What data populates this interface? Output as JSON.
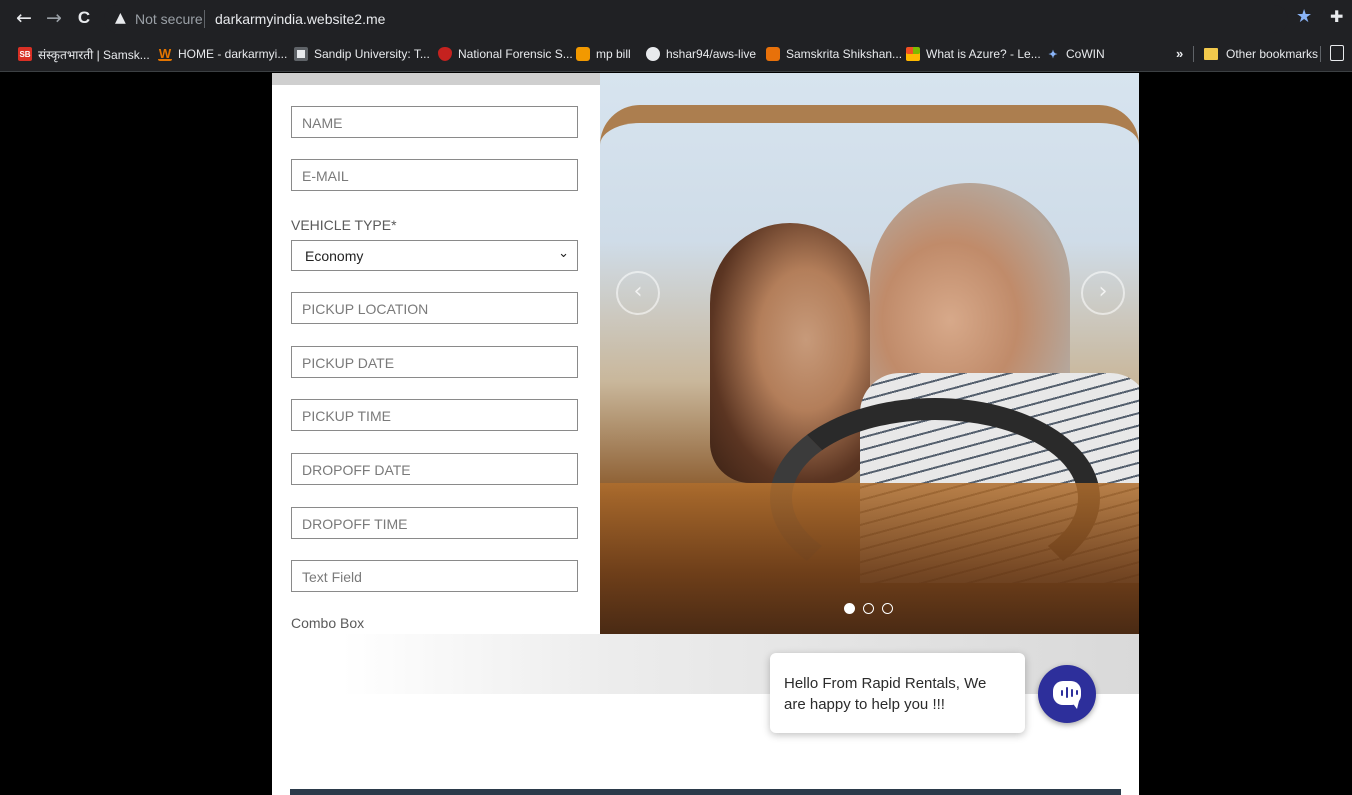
{
  "browser": {
    "nav": {
      "back": "←",
      "forward": "→",
      "reload": "C"
    },
    "security_status": "Not secure",
    "url": "darkarmyindia.website2.me",
    "more_bookmarks": "»",
    "other_bookmarks": "Other bookmarks"
  },
  "bookmarks": [
    {
      "label": "संस्कृतभारती | Samsk...",
      "icon": "sb-icon",
      "color": "#d93025",
      "glyph": "SB"
    },
    {
      "label": "HOME - darkarmyi...",
      "icon": "w-icon",
      "color": "#e37400",
      "glyph": "W"
    },
    {
      "label": "Sandip University: T...",
      "icon": "sandip-icon",
      "color": "#5f6368",
      "glyph": ""
    },
    {
      "label": "National Forensic S...",
      "icon": "nfs-icon",
      "color": "#a142f4",
      "glyph": ""
    },
    {
      "label": "mp bill",
      "icon": "mpbill-icon",
      "color": "#f29900",
      "glyph": ""
    },
    {
      "label": "hshar94/aws-live",
      "icon": "github-icon",
      "color": "#e8eaed",
      "glyph": ""
    },
    {
      "label": "Samskrita Shikshan...",
      "icon": "samskrita-icon",
      "color": "#e8710a",
      "glyph": ""
    },
    {
      "label": "What is Azure? - Le...",
      "icon": "microsoft-icon",
      "color": "#34a853",
      "glyph": ""
    },
    {
      "label": "CoWIN",
      "icon": "cowin-icon",
      "color": "#8ab4f8",
      "glyph": "✦"
    }
  ],
  "form": {
    "name_placeholder": "NAME",
    "email_placeholder": "E-MAIL",
    "vehicle_type_label": "VEHICLE TYPE*",
    "vehicle_type_value": "Economy",
    "pickup_location_placeholder": "PICKUP LOCATION",
    "pickup_date_placeholder": "PICKUP DATE",
    "pickup_time_placeholder": "PICKUP TIME",
    "dropoff_date_placeholder": "DROPOFF DATE",
    "dropoff_time_placeholder": "DROPOFF TIME",
    "text_field_placeholder": "Text Field",
    "combo_box_label": "Combo Box"
  },
  "slider": {
    "prev": "‹",
    "next": "›",
    "slide_count": 3,
    "active_slide": 1
  },
  "chat": {
    "message": "Hello From Rapid Rentals, We are happy to help you !!!",
    "accent": "#2d2f9b"
  }
}
